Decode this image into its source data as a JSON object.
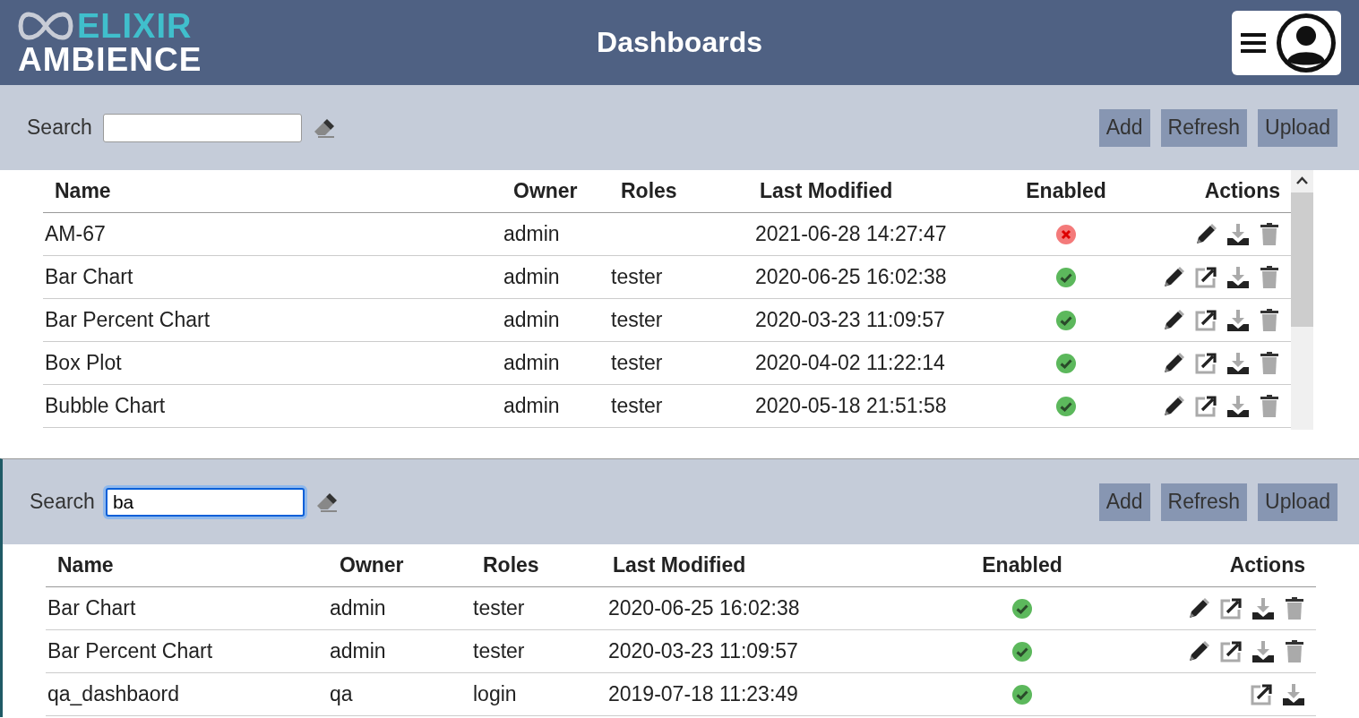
{
  "header": {
    "logo_top": "ELIXIR",
    "logo_bottom": "AMBIENCE",
    "title": "Dashboards"
  },
  "panels": [
    {
      "search": {
        "label": "Search"
      },
      "buttons": [
        "Add",
        "Refresh",
        "Upload"
      ],
      "columns": [
        "Name",
        "Owner",
        "Roles",
        "Last Modified",
        "Enabled",
        "Actions"
      ],
      "rows": [
        {
          "name": "AM-67",
          "owner": "admin",
          "modified": "2021-06-28 14:27:47",
          "enabled": false,
          "can_edit": true,
          "can_open": false,
          "can_download": true,
          "can_delete": true
        },
        {
          "name": "Bar Chart",
          "owner": "admin",
          "roles": "tester",
          "modified": "2020-06-25 16:02:38",
          "enabled": true,
          "can_edit": true,
          "can_open": true,
          "can_download": true,
          "can_delete": true
        },
        {
          "name": "Bar Percent Chart",
          "owner": "admin",
          "roles": "tester",
          "modified": "2020-03-23 11:09:57",
          "enabled": true,
          "can_edit": true,
          "can_open": true,
          "can_download": true,
          "can_delete": true
        },
        {
          "name": "Box Plot",
          "owner": "admin",
          "roles": "tester",
          "modified": "2020-04-02 11:22:14",
          "enabled": true,
          "can_edit": true,
          "can_open": true,
          "can_download": true,
          "can_delete": true
        },
        {
          "name": "Bubble Chart",
          "owner": "admin",
          "roles": "tester",
          "modified": "2020-05-18 21:51:58",
          "enabled": true,
          "can_edit": true,
          "can_open": true,
          "can_download": true,
          "can_delete": true
        }
      ]
    },
    {
      "search": {
        "label": "Search",
        "value": "ba"
      },
      "buttons": [
        "Add",
        "Refresh",
        "Upload"
      ],
      "columns": [
        "Name",
        "Owner",
        "Roles",
        "Last Modified",
        "Enabled",
        "Actions"
      ],
      "rows": [
        {
          "name": "Bar Chart",
          "owner": "admin",
          "roles": "tester",
          "modified": "2020-06-25 16:02:38",
          "enabled": true,
          "can_edit": true,
          "can_open": true,
          "can_download": true,
          "can_delete": true
        },
        {
          "name": "Bar Percent Chart",
          "owner": "admin",
          "roles": "tester",
          "modified": "2020-03-23 11:09:57",
          "enabled": true,
          "can_edit": true,
          "can_open": true,
          "can_download": true,
          "can_delete": true
        },
        {
          "name": "qa_dashbaord",
          "owner": "qa",
          "roles": "login",
          "modified": "2019-07-18 11:23:49",
          "enabled": true,
          "can_edit": false,
          "can_open": true,
          "can_download": true,
          "can_delete": false
        }
      ]
    }
  ]
}
